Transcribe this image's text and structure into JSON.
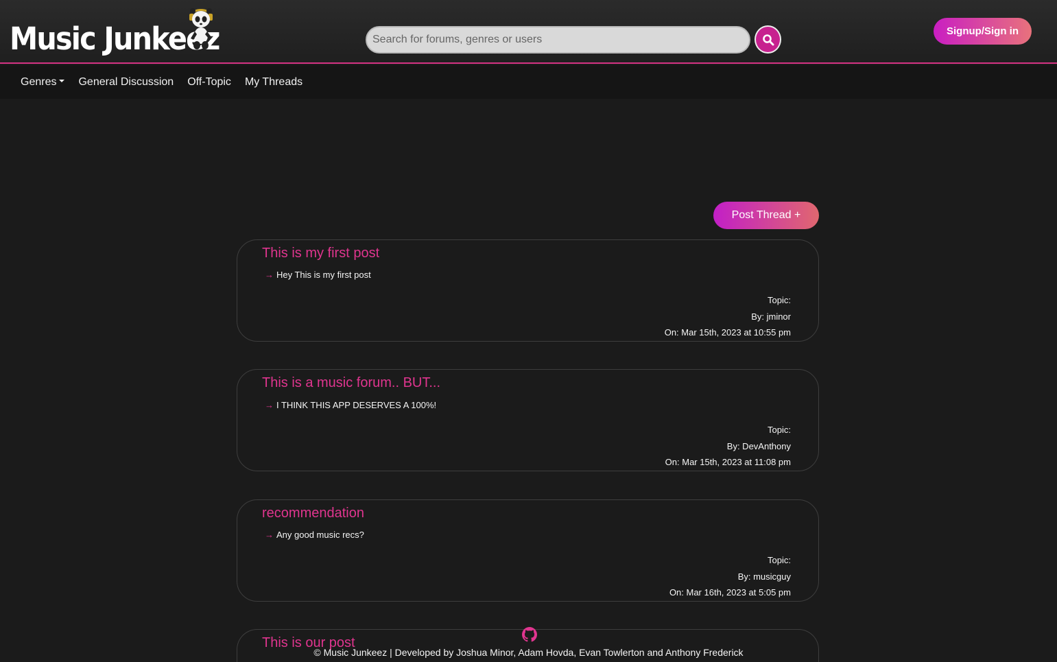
{
  "header": {
    "logo_text": "Music Junkeez",
    "search_placeholder": "Search for forums, genres or users",
    "signin_label": "Signup/Sign in"
  },
  "nav": {
    "items": [
      "Genres",
      "General Discussion",
      "Off-Topic",
      "My Threads"
    ]
  },
  "post_thread_label": "Post Thread +",
  "posts": [
    {
      "title": "This is my first post",
      "body": "Hey This is my first post",
      "topic": "Topic:",
      "by": "By: jminor",
      "on": "On: Mar 15th, 2023 at 10:55 pm"
    },
    {
      "title": "This is a music forum.. BUT...",
      "body": "I THINK THIS APP DESERVES A 100%!",
      "topic": "Topic:",
      "by": "By: DevAnthony",
      "on": "On: Mar 15th, 2023 at 11:08 pm"
    },
    {
      "title": "recommendation",
      "body": "Any good music recs?",
      "topic": "Topic:",
      "by": "By: musicguy",
      "on": "On: Mar 16th, 2023 at 5:05 pm"
    },
    {
      "title": "This is our post"
    }
  ],
  "footer": {
    "text": "© Music Junkeez | Developed by Joshua Minor, Adam Hovda, Evan Towlerton and Anthony Frederick"
  },
  "colors": {
    "accent": "#d63384",
    "background": "#1b1b1b"
  },
  "icons": [
    "panda-logo-icon",
    "search-icon",
    "caret-down-icon",
    "arrow-right-icon",
    "github-icon"
  ]
}
